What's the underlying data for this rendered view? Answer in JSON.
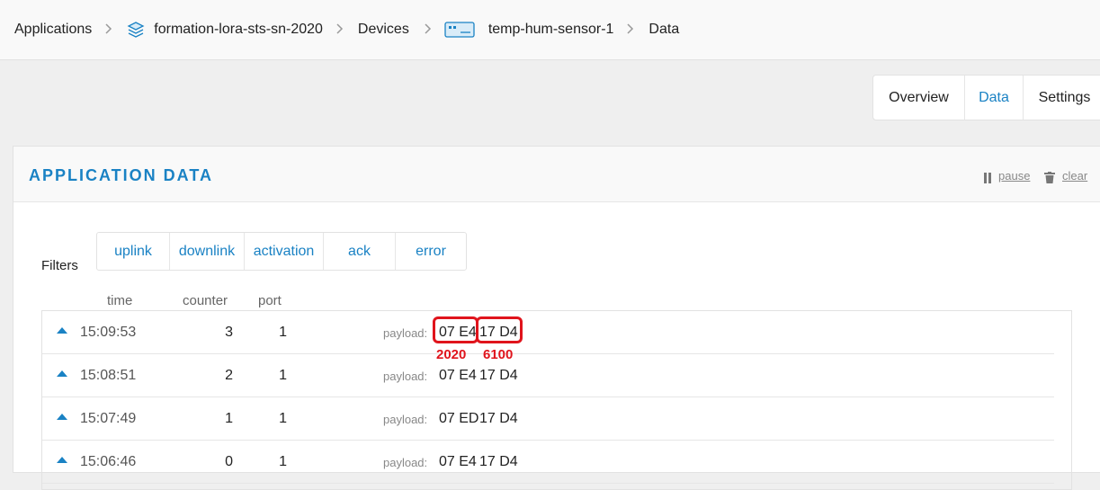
{
  "breadcrumb": {
    "items": [
      "Applications",
      "formation-lora-sts-sn-2020",
      "Devices",
      "temp-hum-sensor-1",
      "Data"
    ]
  },
  "tabs": [
    {
      "label": "Overview",
      "active": false
    },
    {
      "label": "Data",
      "active": true
    },
    {
      "label": "Settings",
      "active": false
    }
  ],
  "panel": {
    "title": "APPLICATION DATA",
    "pause": "pause",
    "clear": "clear"
  },
  "filters": {
    "label": "Filters",
    "buttons": [
      "uplink",
      "downlink",
      "activation",
      "ack",
      "error"
    ]
  },
  "columns": {
    "time": "time",
    "counter": "counter",
    "port": "port"
  },
  "rows": [
    {
      "time": "15:09:53",
      "counter": "3",
      "port": "1",
      "payload_label": "payload:",
      "bytes": [
        "07 E4",
        "17 D4"
      ]
    },
    {
      "time": "15:08:51",
      "counter": "2",
      "port": "1",
      "payload_label": "payload:",
      "bytes": [
        "07 E4",
        "17 D4"
      ]
    },
    {
      "time": "15:07:49",
      "counter": "1",
      "port": "1",
      "payload_label": "payload:",
      "bytes": [
        "07 ED",
        "17 D4"
      ]
    },
    {
      "time": "15:06:46",
      "counter": "0",
      "port": "1",
      "payload_label": "payload:",
      "bytes": [
        "07 E4",
        "17 D4"
      ]
    }
  ],
  "annotations": [
    "2020",
    "6100"
  ],
  "colors": {
    "accent": "#1a82c4",
    "highlight": "#e0141c"
  }
}
